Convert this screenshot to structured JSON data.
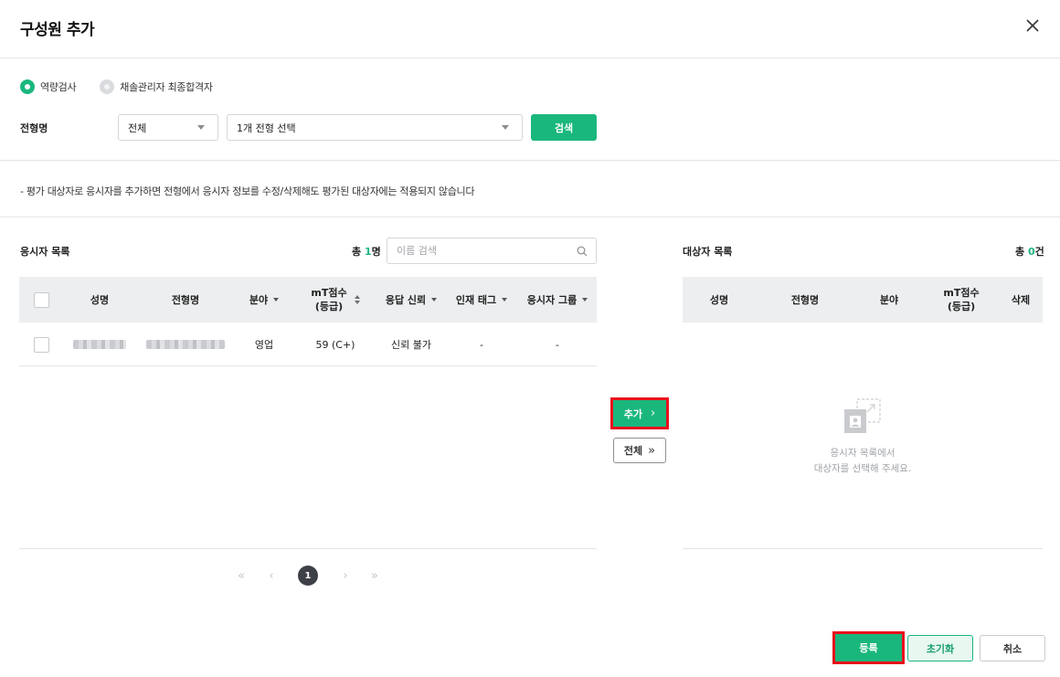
{
  "dialog": {
    "title": "구성원 추가",
    "close_icon": "close-icon"
  },
  "filter": {
    "radios": [
      {
        "label": "역량검사",
        "checked": true
      },
      {
        "label": "채솔관리자 최종합격자",
        "checked": false
      }
    ],
    "stage_label": "전형명",
    "select_all": "전체",
    "select_stage": "1개 전형 선택",
    "search_button": "검색"
  },
  "notice": "- 평가 대상자로 응시자를 추가하면 전형에서 응시자 정보를 수정/삭제해도 평가된 대상자에는 적용되지 않습니다",
  "applicants": {
    "title": "응시자 목록",
    "count_prefix": "총 ",
    "count": "1",
    "count_suffix": "명",
    "search_placeholder": "이름 검색",
    "columns": [
      "성명",
      "전형명",
      "분야",
      "mT점수",
      "(등급)",
      "응답 신뢰",
      "인재 태그",
      "응시자 그룹"
    ],
    "rows": [
      {
        "field": "영업",
        "score": "59 (C+)",
        "reliability": "신뢰 불가",
        "tag": "-",
        "group": "-"
      }
    ],
    "pagination": {
      "first": "«",
      "prev": "‹",
      "current": "1",
      "next": "›",
      "last": "»"
    }
  },
  "move": {
    "add_label": "추가",
    "add_arrow": "›",
    "all_label": "전체",
    "all_arrow": "»"
  },
  "targets": {
    "title": "대상자 목록",
    "count_prefix": "총 ",
    "count": "0",
    "count_suffix": "건",
    "columns": [
      "성명",
      "전형명",
      "분야",
      "mT점수",
      "(등급)",
      "삭제"
    ],
    "empty_line1": "응시자 목록에서",
    "empty_line2": "대상자를 선택해 주세요."
  },
  "footer": {
    "register": "등록",
    "reset": "초기화",
    "cancel": "취소"
  },
  "colors": {
    "accent": "#1ab77d",
    "highlight": "#e8121c"
  }
}
